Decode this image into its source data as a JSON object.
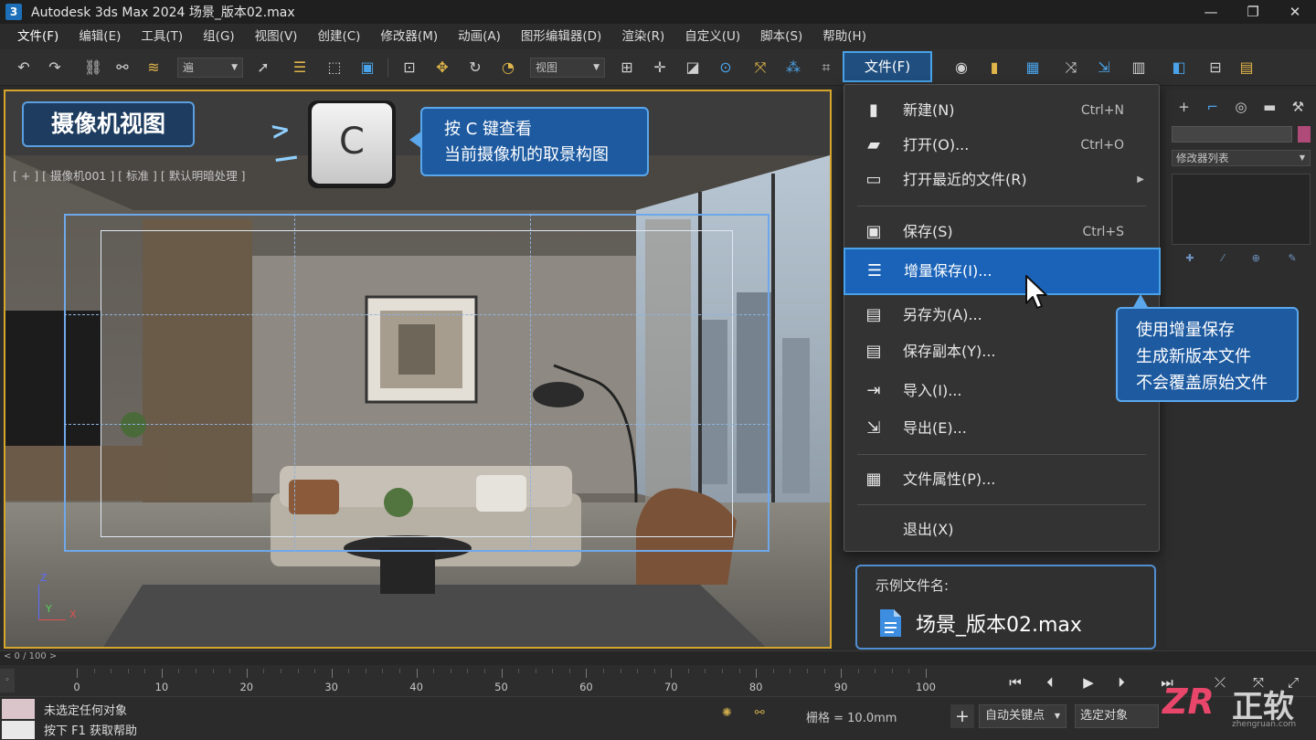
{
  "window": {
    "title": "Autodesk 3ds Max 2024   场景_版本02.max",
    "logo_text": "3",
    "controls": [
      "—",
      "❐",
      "✕"
    ]
  },
  "menubar": {
    "items": [
      "文件(F)",
      "编辑(E)",
      "工具(T)",
      "组(G)",
      "视图(V)",
      "创建(C)",
      "修改器(M)",
      "动画(A)",
      "图形编辑器(D)",
      "渲染(R)",
      "自定义(U)",
      "脚本(S)",
      "帮助(H)"
    ]
  },
  "toolbar": {
    "selection_filter": "遍",
    "ref_coord": "视图",
    "file_button": "文件(F)"
  },
  "viewport": {
    "badge": "摄像机视图",
    "label": "[ + ] [ 摄像机001 ] [ 标准 ] [ 默认明暗处理 ]",
    "key": "C",
    "callout_line1": "按 C 键查看",
    "callout_line2": "当前摄像机的取景构图",
    "axis_z": "Z",
    "axis_y": "Y",
    "axis_x": "X"
  },
  "file_menu": {
    "items": [
      {
        "label": "新建(N)",
        "shortcut": "Ctrl+N"
      },
      {
        "label": "打开(O)...",
        "shortcut": "Ctrl+O"
      },
      {
        "label": "打开最近的文件(R)",
        "shortcut": ""
      },
      {
        "label": "保存(S)",
        "shortcut": "Ctrl+S"
      },
      {
        "label": "增量保存(I)...",
        "shortcut": ""
      },
      {
        "label": "另存为(A)...",
        "shortcut": ""
      },
      {
        "label": "保存副本(Y)...",
        "shortcut": ""
      },
      {
        "label": "导入(I)...",
        "shortcut": ""
      },
      {
        "label": "导出(E)...",
        "shortcut": ""
      },
      {
        "label": "文件属性(P)...",
        "shortcut": ""
      },
      {
        "label": "退出(X)",
        "shortcut": ""
      }
    ]
  },
  "callout_right": {
    "line1": "使用增量保存",
    "line2": "生成新版本文件",
    "line3": "不会覆盖原始文件"
  },
  "example": {
    "title": "示例文件名:",
    "filename": "场景_版本02.max"
  },
  "command_panel": {
    "modifier_list": "修改器列表",
    "object_color": "#b04a78"
  },
  "timeline": {
    "slider_label": "< 0 / 100 >",
    "ticks": [
      "0",
      "10",
      "20",
      "30",
      "40",
      "50",
      "60",
      "70",
      "80",
      "90",
      "100"
    ]
  },
  "statusbar": {
    "line1": "未选定任何对象",
    "line2": "按下 F1 获取帮助",
    "grid": "栅格 = 10.0mm",
    "autokey": "自动关键点",
    "selected": "选定对象"
  },
  "watermark": {
    "logo": "ZR",
    "text": "正软",
    "url": "zhengruan.com"
  },
  "colors": {
    "accent": "#4aa3e8",
    "highlight": "#1a63b8",
    "viewport_border": "#d6a62c"
  }
}
